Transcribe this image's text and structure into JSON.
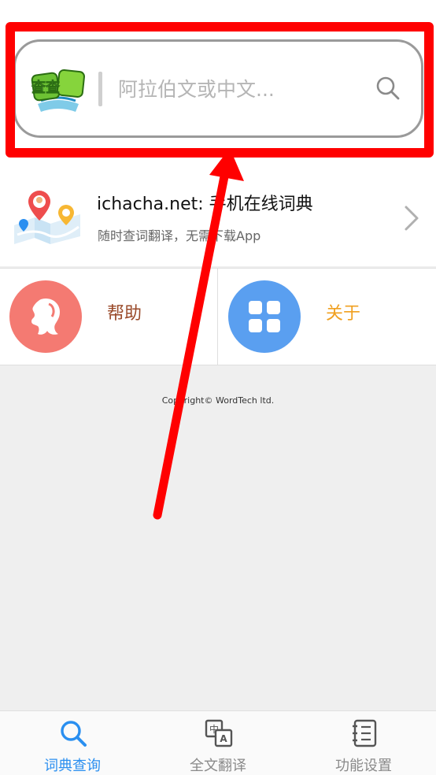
{
  "search": {
    "placeholder": "阿拉伯文或中文...",
    "logo_text": "查查"
  },
  "promo": {
    "title": "ichacha.net: 手机在线词典",
    "subtitle": "随时查词翻译，无需下载App"
  },
  "grid": {
    "help_label": "帮助",
    "about_label": "关于"
  },
  "footer": {
    "copyright": "Copyright© WordTech ltd."
  },
  "tabbar": {
    "tabs": [
      {
        "label": "词典查询",
        "icon": "search-icon",
        "active": true
      },
      {
        "label": "全文翻译",
        "icon": "translate-icon",
        "active": false
      },
      {
        "label": "功能设置",
        "icon": "notebook-icon",
        "active": false
      }
    ]
  },
  "colors": {
    "accent": "#2a8ff0",
    "highlight": "#ff0000",
    "help_circle": "#f47a72",
    "about_circle": "#5a9ff0",
    "help_label": "#9a4a2a",
    "about_label": "#f0a020",
    "inactive_tab": "#8a8a8a"
  }
}
